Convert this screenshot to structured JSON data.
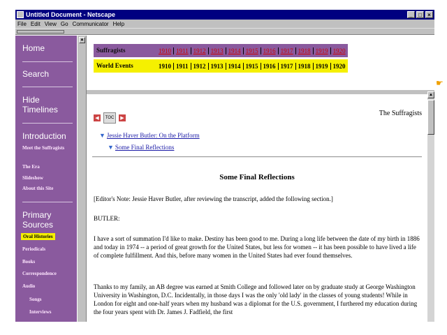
{
  "window": {
    "title": "Untitled Document - Netscape",
    "controls": [
      "_",
      "□",
      "×"
    ]
  },
  "menu": [
    "File",
    "Edit",
    "View",
    "Go",
    "Communicator",
    "Help"
  ],
  "sidebar": {
    "home": "Home",
    "search": "Search",
    "hide_timelines": "Hide Timelines",
    "introduction": "Introduction",
    "intro_links": [
      "Meet the Suffragists",
      "The Era",
      "Slideshow",
      "About this Site"
    ],
    "primary_sources": "Primary Sources",
    "source_links": [
      "Oral Histories",
      "Periodicals",
      "Books",
      "Correspondence",
      "Audio"
    ],
    "audio_links": [
      "Songs",
      "Interviews"
    ]
  },
  "timeline": {
    "rows": [
      {
        "label": "Suffragists",
        "years": [
          "1910",
          "1911",
          "1912",
          "1913",
          "1914",
          "1915",
          "1916",
          "1917",
          "1918",
          "1919",
          "1920"
        ]
      },
      {
        "label": "World Events",
        "years": [
          "1910",
          "1911",
          "1912",
          "1913",
          "1914",
          "1915",
          "1916",
          "1917",
          "1918",
          "1919",
          "1920"
        ]
      }
    ]
  },
  "content": {
    "toc_label": "TOC",
    "section_title": "The Suffragists",
    "breadcrumb_1": "Jessie Haver Butler: On the Platform",
    "breadcrumb_2": "Some Final Reflections",
    "heading": "Some Final Reflections",
    "note": "[Editor's Note: Jessie Haver Butler, after reviewing the transcript, added the following section.]",
    "speaker": "BUTLER:",
    "para1": "I have a sort of summation I'd like to make. Destiny has been good to me. During a long life between the date of my birth in 1886 and today in 1974 -- a period of great growth for the United States, but less for women -- it has been possible to have lived a life of complete fulfillment. And this, before many women in the United States had ever found themselves.",
    "para2": "Thanks to my family, an AB degree was earned at Smith College and followed later on by graduate study at George Washington University in Washington, D.C. Incidentally, in those days I was the only 'old lady' in the classes of young students! While in London for eight and one-half years when my husband was a diplomat for the U.S. government, I furthered my education during the four years spent with Dr. James J. Fadfield, the first"
  }
}
